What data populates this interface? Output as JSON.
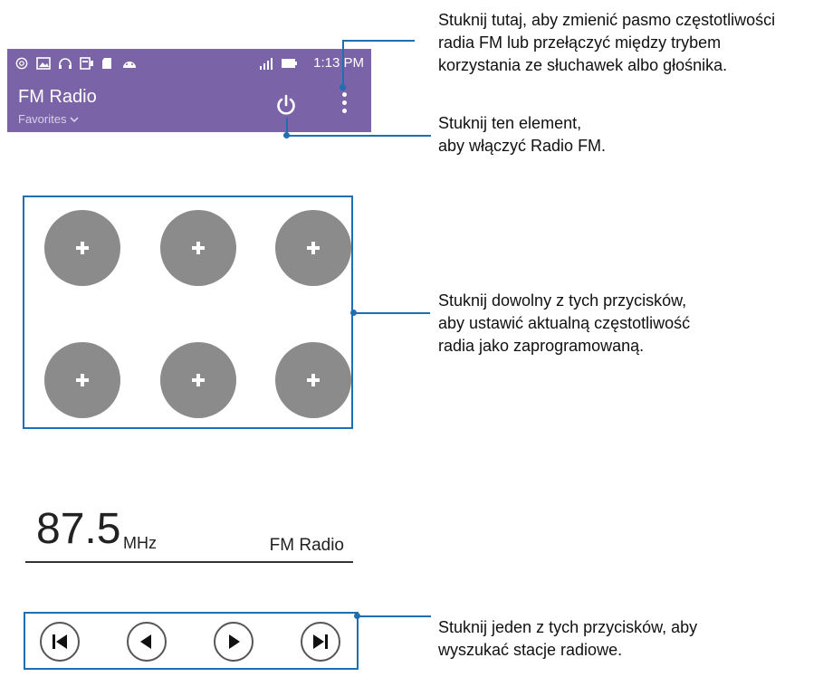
{
  "status_bar": {
    "time": "1:13 PM",
    "icons": [
      "chrome-icon",
      "image-icon",
      "headphones-icon",
      "sim-icon",
      "sd-card-icon",
      "android-icon",
      "signal-icon",
      "battery-icon"
    ]
  },
  "app_bar": {
    "title": "FM Radio",
    "subtitle": "Favorites",
    "power_icon": "power-icon",
    "menu_icon": "more-vert-icon"
  },
  "presets": [
    {
      "label": "+"
    },
    {
      "label": "+"
    },
    {
      "label": "+"
    },
    {
      "label": "+"
    },
    {
      "label": "+"
    },
    {
      "label": "+"
    }
  ],
  "tuner": {
    "frequency": "87.5",
    "unit": "MHz",
    "label": "FM Radio"
  },
  "controls": [
    "skip-previous-icon",
    "seek-back-icon",
    "seek-forward-icon",
    "skip-next-icon"
  ],
  "callouts": {
    "menu": [
      "Stuknij tutaj, aby zmienić pasmo częstotliwości",
      "radia FM lub przełączyć między trybem",
      "korzystania ze słuchawek albo głośnika."
    ],
    "power": [
      "Stuknij ten element,",
      "aby włączyć Radio FM."
    ],
    "presets": [
      "Stuknij dowolny z tych przycisków,",
      "aby ustawić aktualną częstotliwość",
      "radia jako zaprogramowaną."
    ],
    "controls": [
      "Stuknij jeden z tych przycisków, aby",
      "wyszukać stacje radiowe."
    ]
  },
  "colors": {
    "app_bar": "#7a63a6",
    "accent": "#1f6fb2",
    "preset": "#8b8b8b"
  }
}
